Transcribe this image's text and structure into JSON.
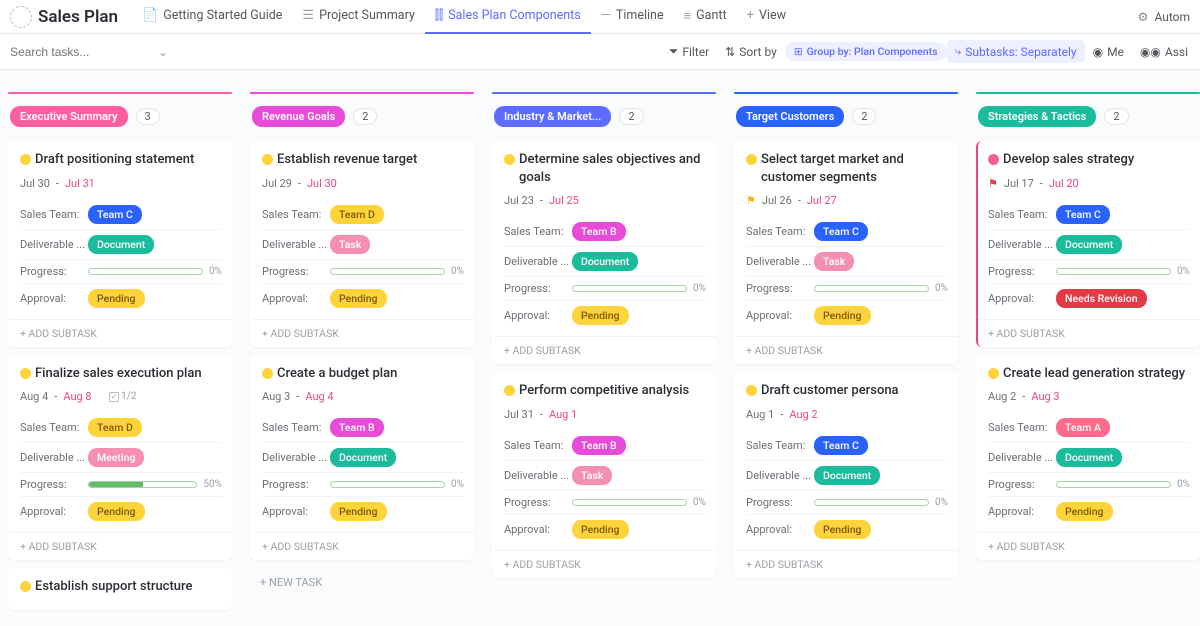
{
  "app": {
    "title": "Sales Plan",
    "tabs": [
      {
        "label": "Getting Started Guide",
        "icon": "doc"
      },
      {
        "label": "Project Summary",
        "icon": "list"
      },
      {
        "label": "Sales Plan Components",
        "icon": "board",
        "active": true
      },
      {
        "label": "Timeline",
        "icon": "timeline"
      },
      {
        "label": "Gantt",
        "icon": "gantt"
      },
      {
        "label": "View",
        "icon": "plus"
      }
    ],
    "automations": "Autom"
  },
  "toolbar": {
    "search_placeholder": "Search tasks...",
    "filter": "Filter",
    "sortby": "Sort by",
    "groupby": "Group by: Plan Components",
    "subtasks": "Subtasks: Separately",
    "me": "Me",
    "assignee": "Assi"
  },
  "labels": {
    "sales_team": "Sales Team:",
    "deliverable": "Deliverable ...",
    "progress": "Progress:",
    "approval": "Approval:",
    "add_subtask": "+ ADD SUBTASK",
    "new_task": "+ NEW TASK"
  },
  "columns": [
    {
      "name": "Executive Summary",
      "color": "#ff5fa2",
      "barcolor": "#ff5fa2",
      "count": "3",
      "cards": [
        {
          "title": "Draft positioning statement",
          "d1": "Jul 30",
          "d2": "Jul 31",
          "team": "Team C",
          "team_cls": "teamC",
          "deliv": "Document",
          "deliv_cls": "doc",
          "progress": 0,
          "progress_label": "0%",
          "approval": "Pending",
          "approval_cls": "pending"
        },
        {
          "title": "Finalize sales execution plan",
          "d1": "Aug 4",
          "d2": "Aug 8",
          "subtask_count": "1/2",
          "team": "Team D",
          "team_cls": "teamD",
          "deliv": "Meeting",
          "deliv_cls": "meeting",
          "progress": 50,
          "progress_label": "50%",
          "approval": "Pending",
          "approval_cls": "pending"
        },
        {
          "title": "Establish support structure",
          "partial": true
        }
      ]
    },
    {
      "name": "Revenue Goals",
      "color": "#e84bd8",
      "barcolor": "#e84bd8",
      "count": "2",
      "cards": [
        {
          "title": "Establish revenue target",
          "d1": "Jul 29",
          "d2": "Jul 30",
          "team": "Team D",
          "team_cls": "teamD",
          "deliv": "Task",
          "deliv_cls": "task",
          "progress": 0,
          "progress_label": "0%",
          "approval": "Pending",
          "approval_cls": "pending"
        },
        {
          "title": "Create a budget plan",
          "d1": "Aug 3",
          "d2": "Aug 4",
          "team": "Team B",
          "team_cls": "teamB",
          "deliv": "Document",
          "deliv_cls": "doc",
          "progress": 0,
          "progress_label": "0%",
          "approval": "Pending",
          "approval_cls": "pending"
        }
      ],
      "show_new_task": true
    },
    {
      "name": "Industry & Market...",
      "color": "#5b6cff",
      "barcolor": "#5b6cff",
      "count": "2",
      "cards": [
        {
          "title": "Determine sales objectives and goals",
          "d1": "Jul 23",
          "d2": "Jul 25",
          "team": "Team B",
          "team_cls": "teamB",
          "deliv": "Document",
          "deliv_cls": "doc",
          "progress": 0,
          "progress_label": "0%",
          "approval": "Pending",
          "approval_cls": "pending"
        },
        {
          "title": "Perform competitive analysis",
          "d1": "Jul 31",
          "d2": "Aug 1",
          "team": "Team B",
          "team_cls": "teamB",
          "deliv": "Task",
          "deliv_cls": "task",
          "progress": 0,
          "progress_label": "0%",
          "approval": "Pending",
          "approval_cls": "pending"
        }
      ]
    },
    {
      "name": "Target Customers",
      "color": "#2962ff",
      "barcolor": "#2962ff",
      "count": "2",
      "cards": [
        {
          "title": "Select target market and customer segments",
          "d1": "Jul 26",
          "d2": "Jul 27",
          "flag": "yellow",
          "team": "Team C",
          "team_cls": "teamC",
          "deliv": "Task",
          "deliv_cls": "task",
          "progress": 0,
          "progress_label": "0%",
          "approval": "Pending",
          "approval_cls": "pending"
        },
        {
          "title": "Draft customer persona",
          "d1": "Aug 1",
          "d2": "Aug 2",
          "team": "Team C",
          "team_cls": "teamC",
          "deliv": "Document",
          "deliv_cls": "doc",
          "progress": 0,
          "progress_label": "0%",
          "approval": "Pending",
          "approval_cls": "pending"
        }
      ]
    },
    {
      "name": "Strategies & Tactics",
      "color": "#1abc9c",
      "barcolor": "#1abc9c",
      "count": "2",
      "cards": [
        {
          "title": "Develop sales strategy",
          "status": "pink",
          "d1": "Jul 17",
          "d2": "Jul 20",
          "flag": "red",
          "flagged_card": true,
          "team": "Team C",
          "team_cls": "teamC",
          "deliv": "Document",
          "deliv_cls": "doc",
          "progress": 0,
          "progress_label": "0%",
          "approval": "Needs Revision",
          "approval_cls": "needsrev"
        },
        {
          "title": "Create lead generation strategy",
          "d1": "Aug 2",
          "d2": "Aug 3",
          "team": "Team A",
          "team_cls": "teamA",
          "deliv": "Document",
          "deliv_cls": "doc",
          "progress": 0,
          "progress_label": "0%",
          "approval": "Pending",
          "approval_cls": "pending"
        }
      ]
    }
  ]
}
